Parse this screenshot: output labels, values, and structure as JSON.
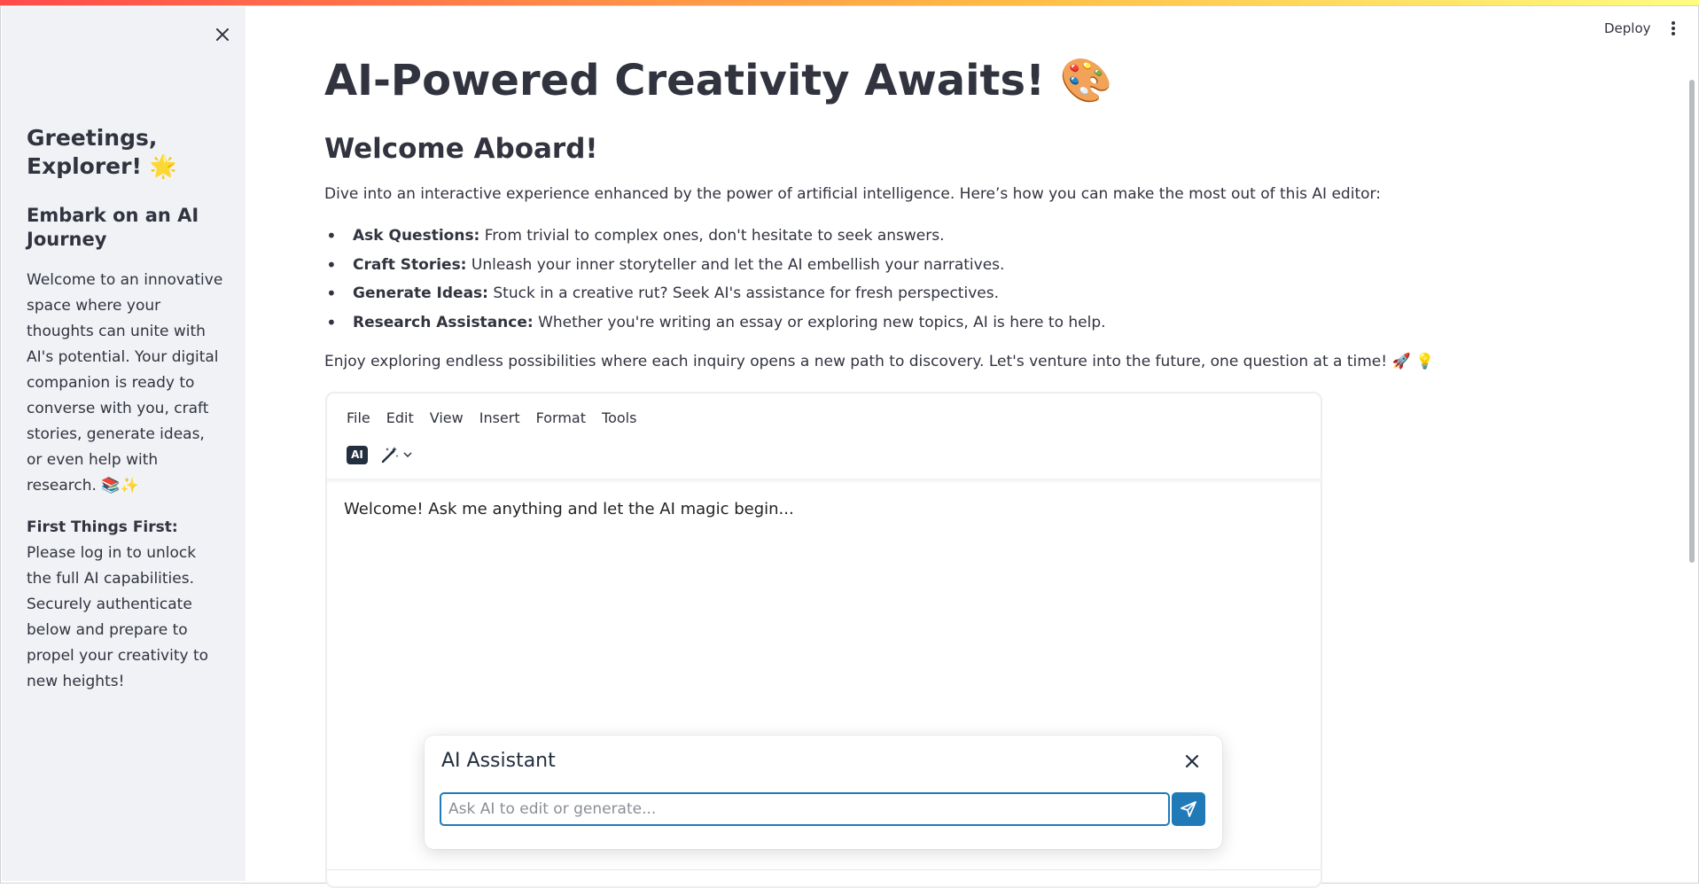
{
  "sidebar": {
    "greeting": "Greetings, Explorer! 🌟",
    "journey_title": "Embark on an AI Journey",
    "welcome_text": "Welcome to an innovative space where your thoughts can unite with AI's potential. Your digital companion is ready to converse with you, craft stories, generate ideas, or even help with research. 📚✨",
    "first_label": "First Things First:",
    "first_text": " Please log in to unlock the full AI capabilities. Securely authenticate below and prepare to propel your creativity to new heights!"
  },
  "header": {
    "deploy_label": "Deploy"
  },
  "main": {
    "title": "AI-Powered Creativity Awaits! 🎨",
    "subtitle": "Welcome Aboard!",
    "intro": "Dive into an interactive experience enhanced by the power of artificial intelligence. Here’s how you can make the most out of this AI editor:",
    "features": [
      {
        "label": "Ask Questions:",
        "text": " From trivial to complex ones, don't hesitate to seek answers."
      },
      {
        "label": "Craft Stories:",
        "text": " Unleash your inner storyteller and let the AI embellish your narratives."
      },
      {
        "label": "Generate Ideas:",
        "text": " Stuck in a creative rut? Seek AI's assistance for fresh perspectives."
      },
      {
        "label": "Research Assistance:",
        "text": " Whether you're writing an essay or exploring new topics, AI is here to help."
      }
    ],
    "outro": "Enjoy exploring endless possibilities where each inquiry opens a new path to discovery. Let's venture into the future, one question at a time! 🚀 💡"
  },
  "editor": {
    "menu": [
      "File",
      "Edit",
      "View",
      "Insert",
      "Format",
      "Tools"
    ],
    "ai_badge": "AI",
    "content": "Welcome! Ask me anything and let the AI magic begin..."
  },
  "assistant": {
    "title": "AI Assistant",
    "placeholder": "Ask AI to edit or generate...",
    "value": ""
  },
  "colors": {
    "accent": "#207ab7",
    "sidebar_bg": "#f0f2f6",
    "text": "#31333f"
  }
}
